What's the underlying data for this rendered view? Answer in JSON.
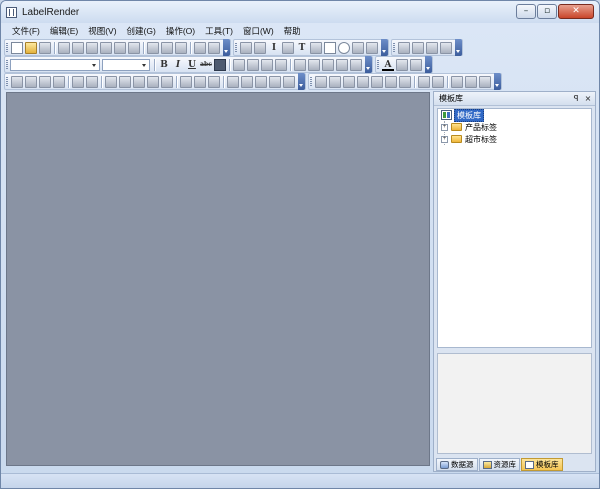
{
  "window": {
    "title": "LabelRender"
  },
  "menu": [
    {
      "label": "文件(F)"
    },
    {
      "label": "编辑(E)"
    },
    {
      "label": "视图(V)"
    },
    {
      "label": "创建(G)"
    },
    {
      "label": "操作(O)"
    },
    {
      "label": "工具(T)"
    },
    {
      "label": "窗口(W)"
    },
    {
      "label": "帮助"
    }
  ],
  "toolbar2": {
    "font_name": "",
    "font_size": "",
    "bold": "B",
    "italic": "I",
    "underline": "U",
    "strike": "abc",
    "text_tool": "T"
  },
  "panel": {
    "title": "模板库",
    "pin": "ꟼ",
    "close": "×"
  },
  "tree": {
    "root": "模板库",
    "children": [
      {
        "label": "产品标签",
        "expander": "+"
      },
      {
        "label": "超市标签",
        "expander": "+"
      }
    ]
  },
  "tabs": [
    {
      "label": "数据源"
    },
    {
      "label": "资源库"
    },
    {
      "label": "模板库",
      "active": true
    }
  ],
  "colors": {
    "workspace": "#8a93a4",
    "selection": "#3169c6",
    "accent": "#3c5d9c"
  }
}
